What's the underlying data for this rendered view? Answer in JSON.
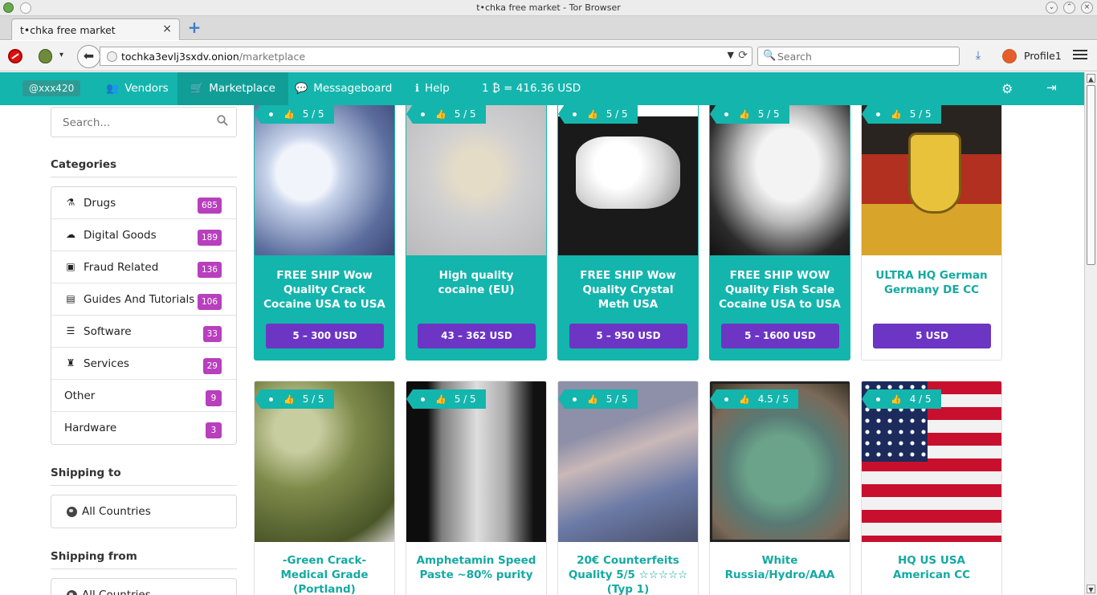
{
  "window": {
    "title": "t•chka free market - Tor Browser",
    "minimize_glyph": "⌄",
    "maximize_glyph": "⌃",
    "close_glyph": "×"
  },
  "tabs": [
    {
      "title": "t•chka free market",
      "close_glyph": "×"
    }
  ],
  "toolbar": {
    "new_tab_glyph": "+",
    "back_glyph": "⬅",
    "url_host": "tochka3evlj3sxdv.onion",
    "url_path": "/marketplace",
    "url_dropdown_glyph": "▼",
    "reload_glyph": "⟳",
    "search_placeholder": "Search",
    "search_glyph": "🔍",
    "profile_label": "Profile1",
    "dropdown_glyph": "▾"
  },
  "header": {
    "user": "@xxx420",
    "nav": [
      {
        "icon": "users-icon",
        "glyph": "👥",
        "label": "Vendors"
      },
      {
        "icon": "cart-icon",
        "glyph": "🛒",
        "label": "Marketplace"
      },
      {
        "icon": "comments-icon",
        "glyph": "💬",
        "label": "Messageboard"
      },
      {
        "icon": "info-icon",
        "glyph": "ℹ",
        "label": "Help"
      }
    ],
    "rate": "1 ₿ = 416.36 USD",
    "settings_glyph": "⚙",
    "logout_glyph": "⇥"
  },
  "sidebar": {
    "search_placeholder": "Search...",
    "categories_heading": "Categories",
    "categories": [
      {
        "label": "Drugs",
        "count": "685",
        "icon": "flask-icon",
        "glyph": "⚗"
      },
      {
        "label": "Digital Goods",
        "count": "189",
        "icon": "cloud-icon",
        "glyph": "☁"
      },
      {
        "label": "Fraud Related",
        "count": "136",
        "icon": "money-icon",
        "glyph": "▣"
      },
      {
        "label": "Guides And Tutorials",
        "count": "106",
        "icon": "book-icon",
        "glyph": "▤"
      },
      {
        "label": "Software",
        "count": "33",
        "icon": "list-icon",
        "glyph": "☰"
      },
      {
        "label": "Services",
        "count": "29",
        "icon": "user-secret-icon",
        "glyph": "♜"
      },
      {
        "label": "Other",
        "count": "9",
        "icon": "",
        "glyph": ""
      },
      {
        "label": "Hardware",
        "count": "3",
        "icon": "",
        "glyph": ""
      }
    ],
    "shipping_to_heading": "Shipping to",
    "shipping_to_value": "All Countries",
    "shipping_from_heading": "Shipping from",
    "shipping_from_value": "All Countries"
  },
  "listings": [
    {
      "rating": "5 / 5",
      "title": "FREE SHIP Wow Quality Crack Cocaine USA to USA",
      "price": "5 – 300 USD",
      "featured": true
    },
    {
      "rating": "5 / 5",
      "title": "High quality cocaine (EU)",
      "price": "43 – 362 USD",
      "featured": true
    },
    {
      "rating": "5 / 5",
      "title": "FREE SHIP Wow Quality Crystal Meth USA",
      "price": "5 – 950 USD",
      "featured": true
    },
    {
      "rating": "5 / 5",
      "title": "FREE SHIP WOW Quality Fish Scale Cocaine USA to USA",
      "price": "5 – 1600 USD",
      "featured": true
    },
    {
      "rating": "5 / 5",
      "title": "ULTRA HQ German Germany DE CC",
      "price": "5 USD",
      "featured": false
    },
    {
      "rating": "5 / 5",
      "title": "-Green Crack- Medical Grade (Portland)",
      "featured": false
    },
    {
      "rating": "5 / 5",
      "title": "Amphetamin Speed Paste ~80% purity",
      "featured": false
    },
    {
      "rating": "5 / 5",
      "title": "20€ Counterfeits Quality 5/5 ☆☆☆☆☆ (Typ 1)",
      "featured": false
    },
    {
      "rating": "4.5 / 5",
      "title": "White Russia/Hydro/AAA",
      "featured": false
    },
    {
      "rating": "4 / 5",
      "title": "HQ US USA American CC",
      "featured": false
    }
  ],
  "colors": {
    "brand": "#14b5ad",
    "price_button": "#6c35c4",
    "count_badge": "#b83fbd"
  }
}
